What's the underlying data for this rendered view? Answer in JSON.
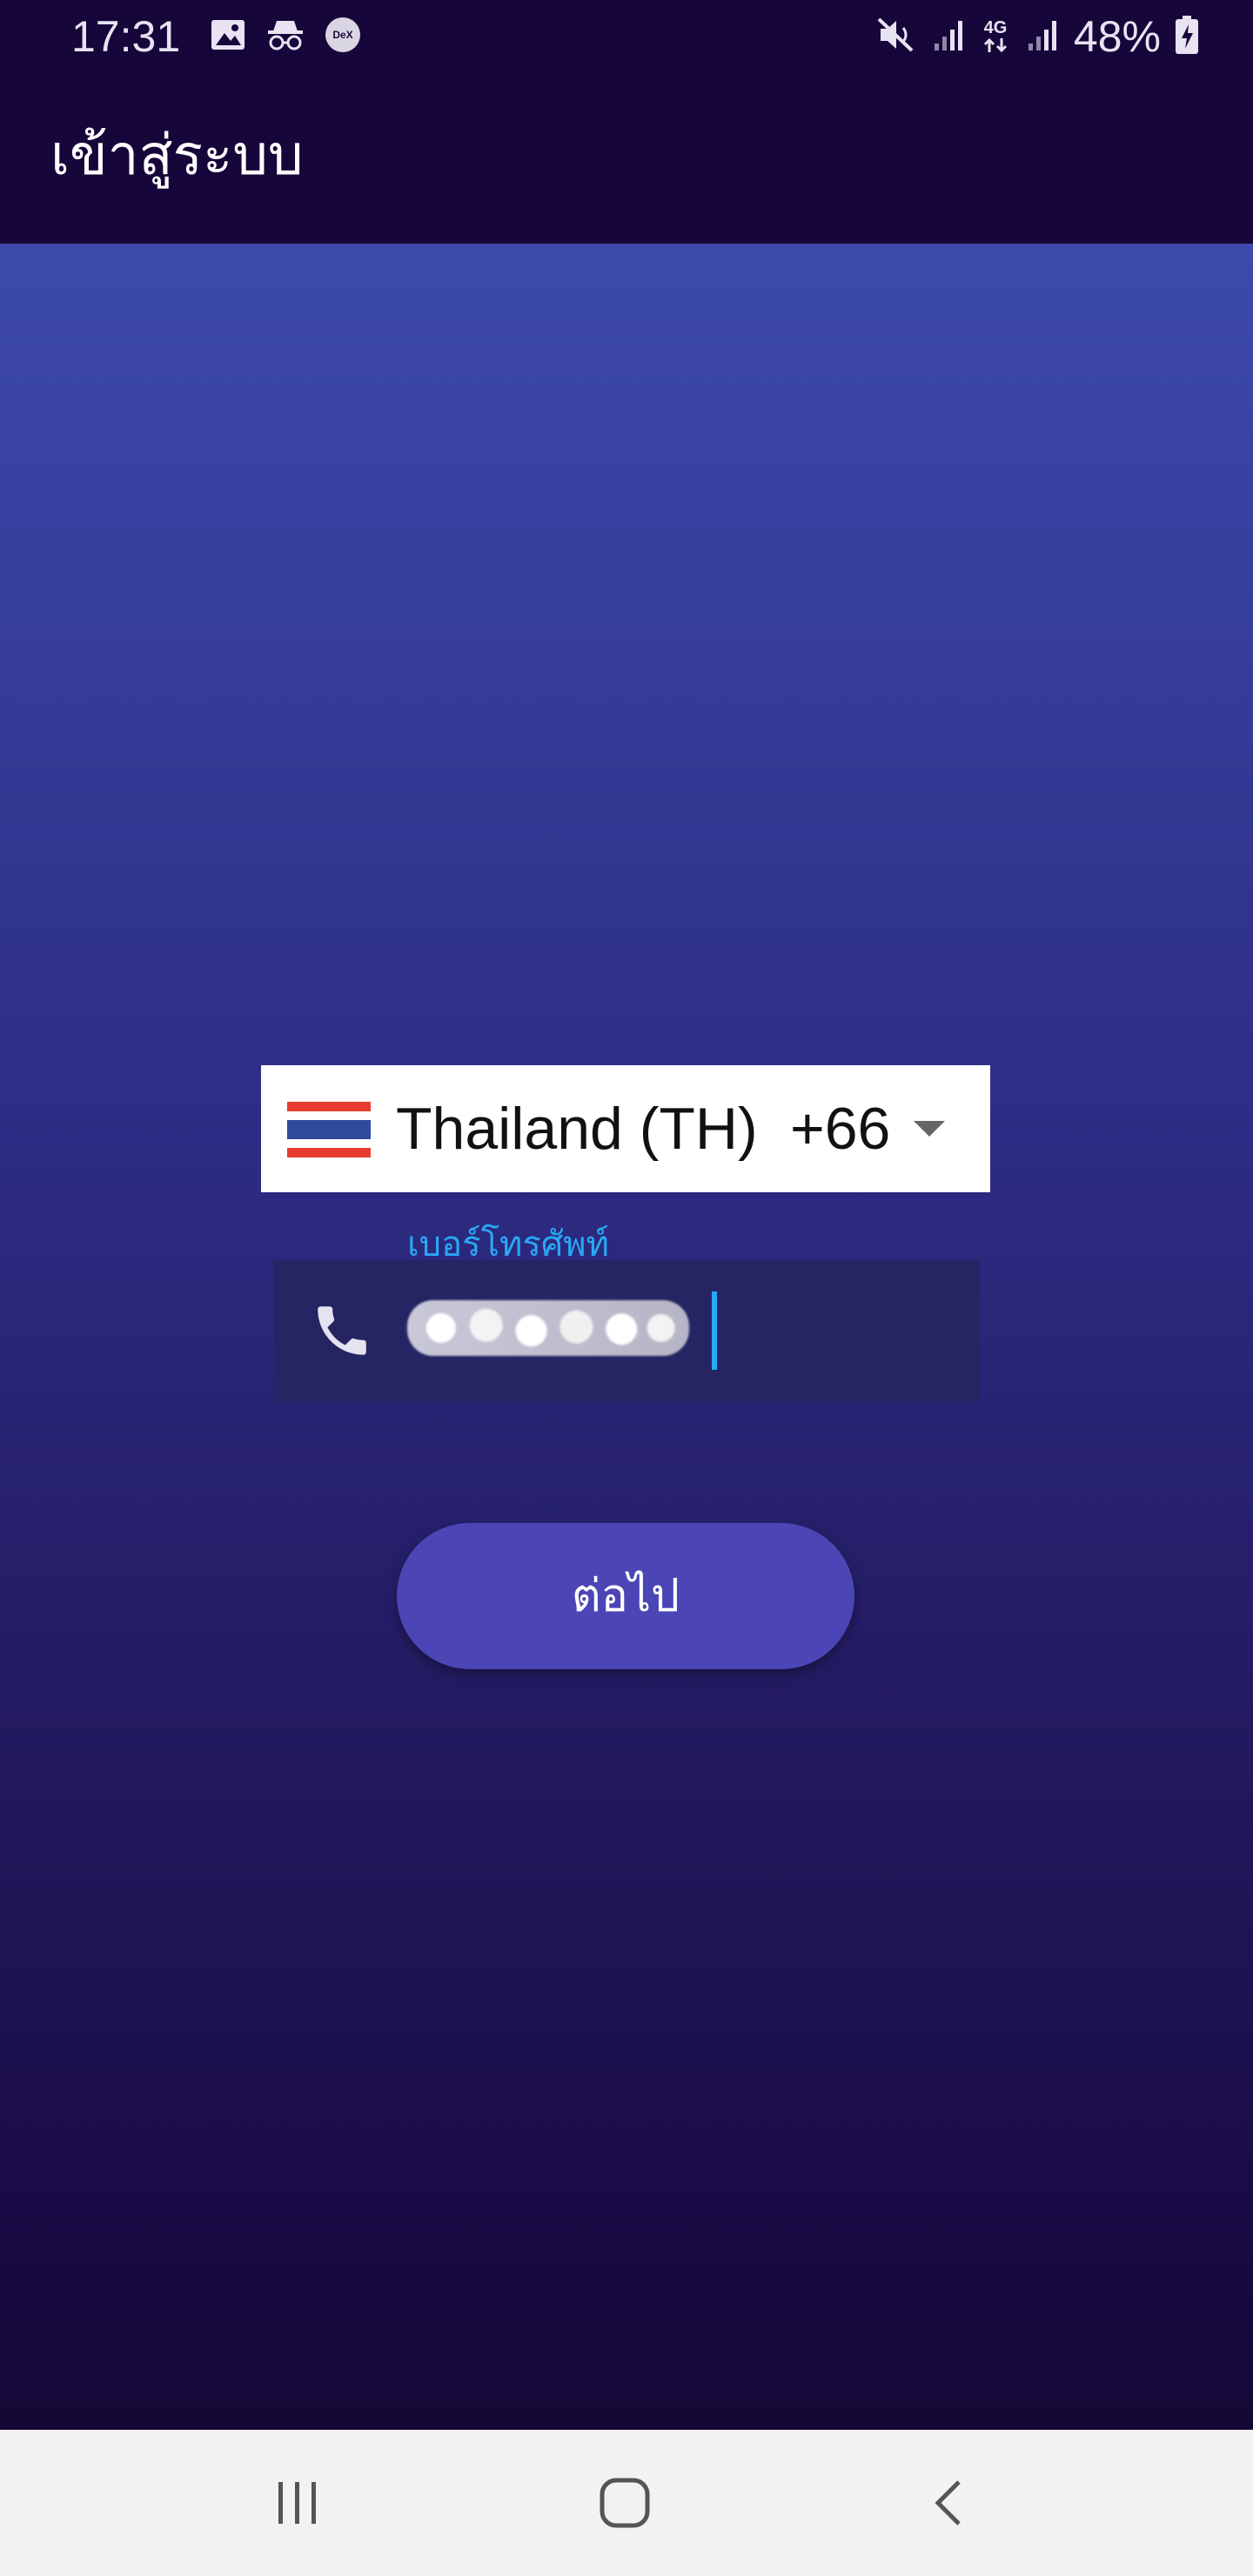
{
  "status_bar": {
    "time": "17:31",
    "battery_percent": "48%",
    "network_label": "4G",
    "left_icons": [
      "image-icon",
      "incognito-icon",
      "dex-icon"
    ],
    "dex_label": "DeX",
    "right_icons": [
      "mute-icon",
      "signal-icon",
      "signal-icon",
      "battery-charging-icon"
    ]
  },
  "app_bar": {
    "title": "เข้าสู่ระบบ"
  },
  "login_form": {
    "country": {
      "name": "Thailand (TH)",
      "dial_code": "+66",
      "flag_icon": "thailand-flag-icon",
      "dropdown_icon": "caret-down-icon"
    },
    "phone": {
      "label": "เบอร์โทรศัพท์",
      "icon": "phone-icon",
      "value": ""
    },
    "next_button": {
      "label": "ต่อไป"
    }
  },
  "nav_bar": {
    "buttons": [
      "recent-apps-icon",
      "home-icon",
      "back-icon"
    ]
  },
  "colors": {
    "top_bar": "#16063a",
    "gradient_top": "#3d4aab",
    "gradient_bottom": "#150735",
    "accent_blue": "#2aa7f3",
    "button": "#4b45b6",
    "field_bg": "#252564"
  }
}
